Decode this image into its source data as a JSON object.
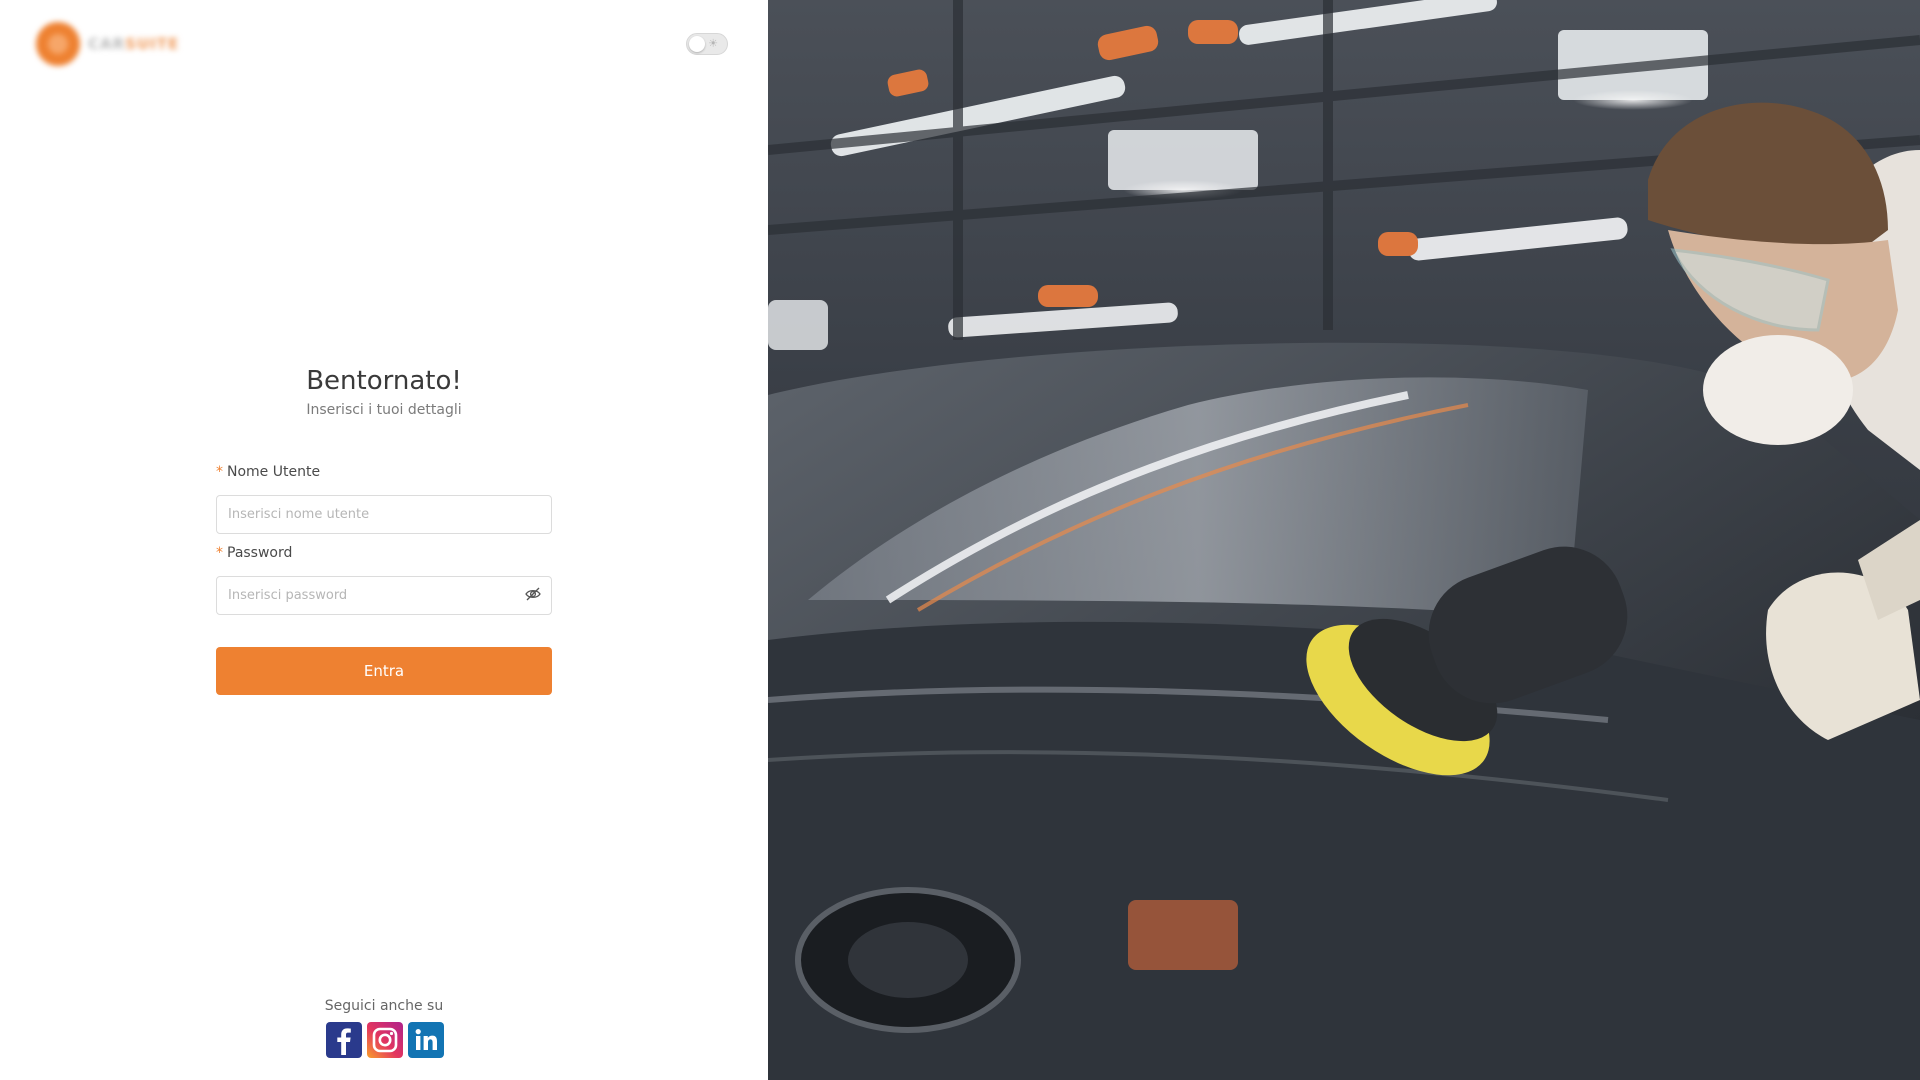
{
  "brand": {
    "logo_text_a": "CAR",
    "logo_text_b": "SUITE",
    "accent_color": "#ee8131"
  },
  "theme_toggle": {
    "icon": "sun-icon",
    "state": "off"
  },
  "login": {
    "title": "Bentornato!",
    "subtitle": "Inserisci i tuoi dettagli",
    "username": {
      "required_mark": "*",
      "label": "Nome Utente",
      "placeholder": "Inserisci nome utente",
      "value": ""
    },
    "password": {
      "required_mark": "*",
      "label": "Password",
      "placeholder": "Inserisci password",
      "value": "",
      "toggle_icon": "eye-off-icon"
    },
    "submit_label": "Entra"
  },
  "social": {
    "caption": "Seguici anche su",
    "links": [
      {
        "network": "facebook",
        "icon": "facebook-icon",
        "color": "#2a3a8c"
      },
      {
        "network": "instagram",
        "icon": "instagram-icon",
        "color": "#e3365f"
      },
      {
        "network": "linkedin",
        "icon": "linkedin-icon",
        "color": "#1274b3"
      }
    ]
  },
  "hero": {
    "subject": "car-detailing-photo"
  }
}
